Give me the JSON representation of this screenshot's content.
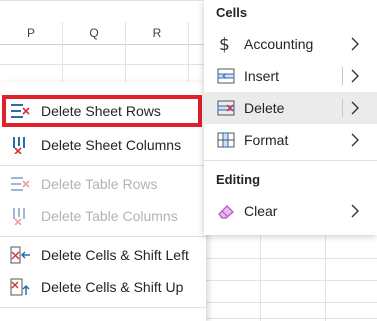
{
  "columns": [
    "P",
    "Q",
    "R"
  ],
  "submenu": {
    "items": [
      {
        "label": "Delete Sheet Rows",
        "icon": "delete-sheet-rows-icon",
        "enabled": true,
        "highlighted": true
      },
      {
        "label": "Delete Sheet Columns",
        "icon": "delete-sheet-columns-icon",
        "enabled": true
      },
      {
        "label": "Delete Table Rows",
        "icon": "delete-table-rows-icon",
        "enabled": false
      },
      {
        "label": "Delete Table Columns",
        "icon": "delete-table-columns-icon",
        "enabled": false
      },
      {
        "label": "Delete Cells & Shift Left",
        "icon": "delete-cells-shift-left-icon",
        "enabled": true
      },
      {
        "label": "Delete Cells & Shift Up",
        "icon": "delete-cells-shift-up-icon",
        "enabled": true
      }
    ]
  },
  "mainmenu": {
    "cells_title": "Cells",
    "editing_title": "Editing",
    "items": [
      {
        "label": "Accounting",
        "icon": "dollar-icon"
      },
      {
        "label": "Insert",
        "icon": "insert-icon"
      },
      {
        "label": "Delete",
        "icon": "delete-icon",
        "active": true
      },
      {
        "label": "Format",
        "icon": "format-icon"
      },
      {
        "label": "Clear",
        "icon": "eraser-icon"
      }
    ]
  },
  "colors": {
    "highlight_border": "#e0202b",
    "icon_blue": "#2b6cb0",
    "icon_red": "#d13438",
    "eraser_purple": "#b44fc2",
    "active_bg": "#ebebeb",
    "disabled_text": "#b3b3b3"
  }
}
